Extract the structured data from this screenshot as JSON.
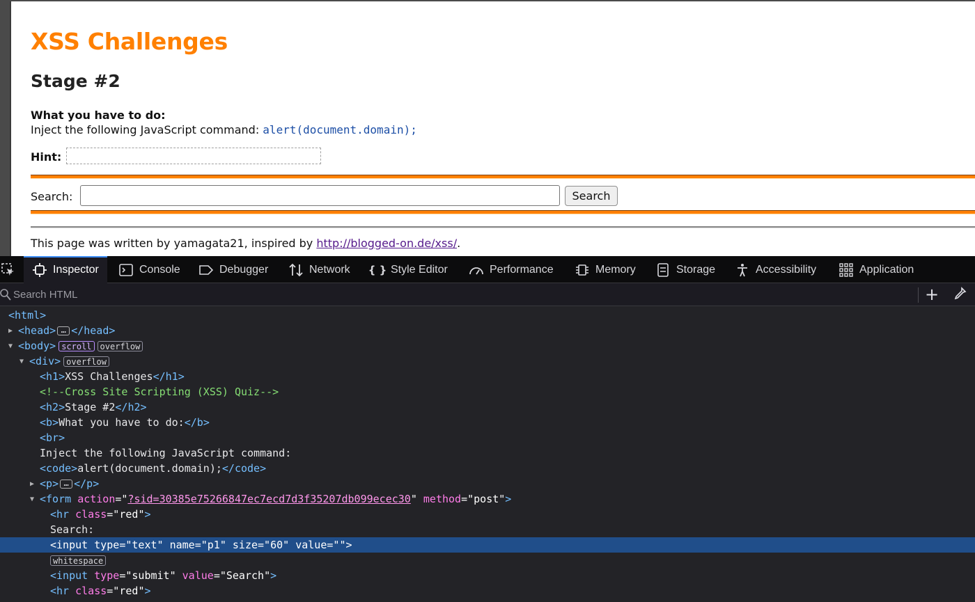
{
  "page": {
    "title": "XSS Challenges",
    "stage": "Stage #2",
    "todo_label": "What you have to do:",
    "inject_text": "Inject the following JavaScript command: ",
    "inject_code": "alert(document.domain);",
    "hint_label": "Hint:",
    "search_label": "Search:",
    "search_value": "",
    "search_button": "Search",
    "footer_text": "This page was written by yamagata21, inspired by ",
    "footer_link": "http://blogged-on.de/xss/",
    "footer_end": "."
  },
  "devtools": {
    "tabs": [
      {
        "label": "Inspector",
        "icon": "inspector-icon"
      },
      {
        "label": "Console",
        "icon": "console-icon"
      },
      {
        "label": "Debugger",
        "icon": "debugger-icon"
      },
      {
        "label": "Network",
        "icon": "network-icon"
      },
      {
        "label": "Style Editor",
        "icon": "style-editor-icon"
      },
      {
        "label": "Performance",
        "icon": "performance-icon"
      },
      {
        "label": "Memory",
        "icon": "memory-icon"
      },
      {
        "label": "Storage",
        "icon": "storage-icon"
      },
      {
        "label": "Accessibility",
        "icon": "accessibility-icon"
      },
      {
        "label": "Application",
        "icon": "application-icon"
      }
    ],
    "search_placeholder": "Search HTML",
    "tree": {
      "html": "html",
      "head": "head",
      "body": "body",
      "badge_scroll": "scroll",
      "badge_overflow": "overflow",
      "div": "div",
      "h1": "h1",
      "h1_text": "XSS Challenges",
      "comment": "<!--Cross Site Scripting (XSS) Quiz-->",
      "h2": "h2",
      "h2_text": "Stage #2",
      "b": "b",
      "b_text": "What you have to do:",
      "br": "br",
      "inject_text": "Inject the following JavaScript command:",
      "code": "code",
      "code_text": "alert(document.domain);",
      "p": "p",
      "form": "form",
      "form_action_attr": "action",
      "form_action": "?sid=30385e75266847ec7ecd7d3f35207db099ecec30",
      "form_method_attr": "method",
      "form_method": "post",
      "hr": "hr",
      "class_attr": "class",
      "hr_class": "red",
      "search_text": "Search:",
      "input": "input",
      "type_attr": "type",
      "name_attr": "name",
      "size_attr": "size",
      "value_attr": "value",
      "input1_type": "text",
      "input1_name": "p1",
      "input1_size": "60",
      "input1_value": "",
      "badge_whitespace": "whitespace",
      "input2_type": "submit",
      "input2_value": "Search"
    }
  }
}
